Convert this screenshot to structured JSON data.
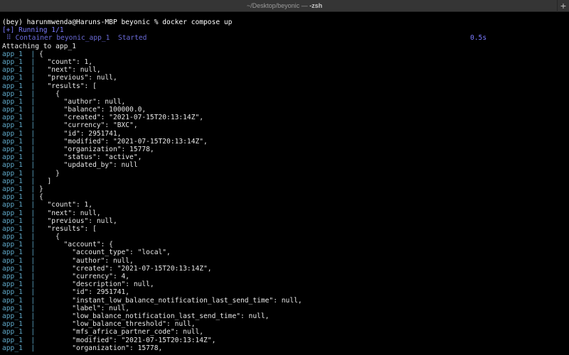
{
  "window": {
    "title_path": "~/Desktop/beyonic — ",
    "title_shell": "-zsh",
    "new_tab_label": "+"
  },
  "terminal": {
    "command_line": "(bey) harunmwenda@Haruns-MBP beyonic % docker compose up",
    "running_line": "[+] Running 1/1",
    "container_line": " ⠿ Container beyonic_app_1  Started",
    "container_time": "0.5s",
    "attach_line": "Attaching to app_1",
    "log_prefix": "app_1  | ",
    "log_lines": [
      "{",
      "  \"count\": 1,",
      "  \"next\": null,",
      "  \"previous\": null,",
      "  \"results\": [",
      "    {",
      "      \"author\": null,",
      "      \"balance\": 100000.0,",
      "      \"created\": \"2021-07-15T20:13:14Z\",",
      "      \"currency\": \"BXC\",",
      "      \"id\": 2951741,",
      "      \"modified\": \"2021-07-15T20:13:14Z\",",
      "      \"organization\": 15778,",
      "      \"status\": \"active\",",
      "      \"updated_by\": null",
      "    }",
      "  ]",
      "}",
      "{",
      "  \"count\": 1,",
      "  \"next\": null,",
      "  \"previous\": null,",
      "  \"results\": [",
      "    {",
      "      \"account\": {",
      "        \"account_type\": \"local\",",
      "        \"author\": null,",
      "        \"created\": \"2021-07-15T20:13:14Z\",",
      "        \"currency\": 4,",
      "        \"description\": null,",
      "        \"id\": 2951741,",
      "        \"instant_low_balance_notification_last_send_time\": null,",
      "        \"label\": null,",
      "        \"low_balance_notification_last_send_time\": null,",
      "        \"low_balance_threshold\": null,",
      "        \"mfs_africa_partner_code\": null,",
      "        \"modified\": \"2021-07-15T20:13:14Z\",",
      "        \"organization\": 15778,"
    ]
  },
  "colors": {
    "background": "#000000",
    "text": "#e8e8e8",
    "compose_status": "#7b7bff",
    "log_prefix": "#5fa8c8",
    "titlebar": "#353535"
  }
}
